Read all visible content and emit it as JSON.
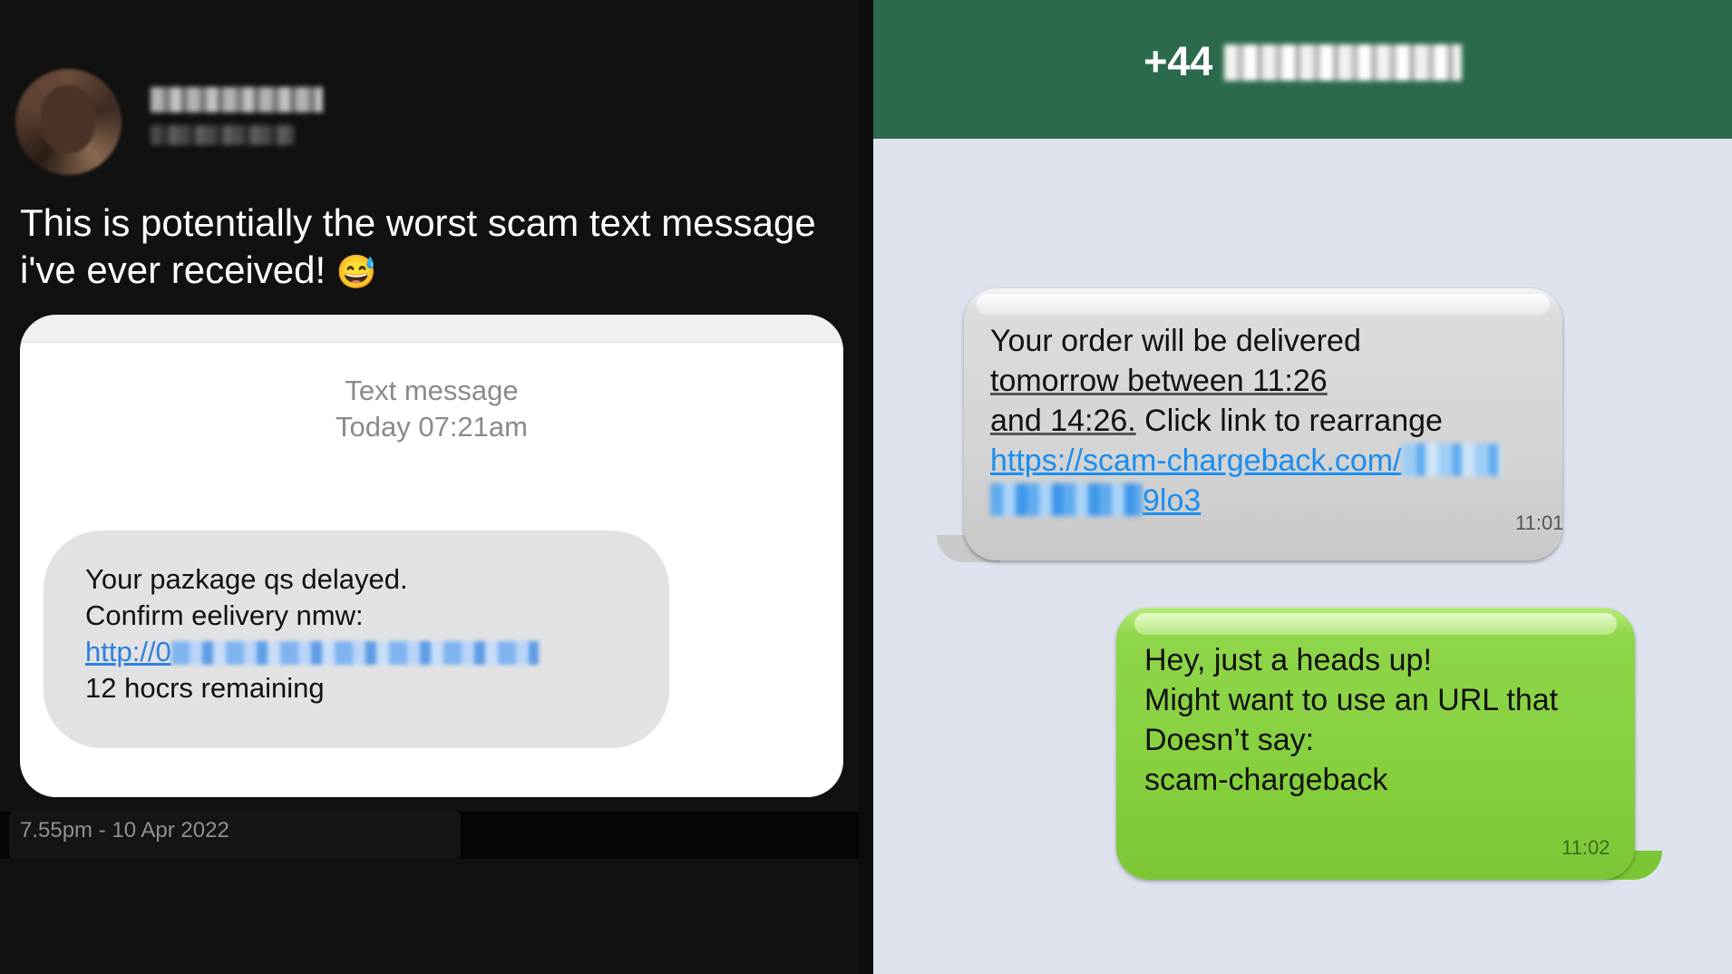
{
  "tweet": {
    "text": "This is potentially the worst scam text message i've ever received!",
    "emoji": "😅",
    "date": "7.55pm - 10 Apr 2022"
  },
  "scam_screenshot": {
    "meta_line1": "Text message",
    "meta_line2": "Today 07:21am",
    "line1": "Your pazkage qs delayed.",
    "line2": "Confirm eelivery nmw:",
    "link_visible": "http://0",
    "line4": "12 hocrs remaining"
  },
  "conversation": {
    "sender_prefix": "+44",
    "incoming": {
      "line1": "Your order will be delivered",
      "line2": "tomorrow between 11:26",
      "line3a": "and 14:26.",
      "line3b": " Click link to rearrange",
      "link_part1": "https://scam-chargeback.com/",
      "link_part2": "9lo3",
      "time": "11:01"
    },
    "outgoing": {
      "line1": "Hey, just a heads up!",
      "line2": "Might want to use an URL that",
      "line3": "Doesn’t say:",
      "line4": "scam-chargeback",
      "time": "11:02"
    }
  },
  "colors": {
    "header_green": "#2b6a4d",
    "bubble_green": "#86d03e",
    "link_blue": "#1a8ef0"
  }
}
